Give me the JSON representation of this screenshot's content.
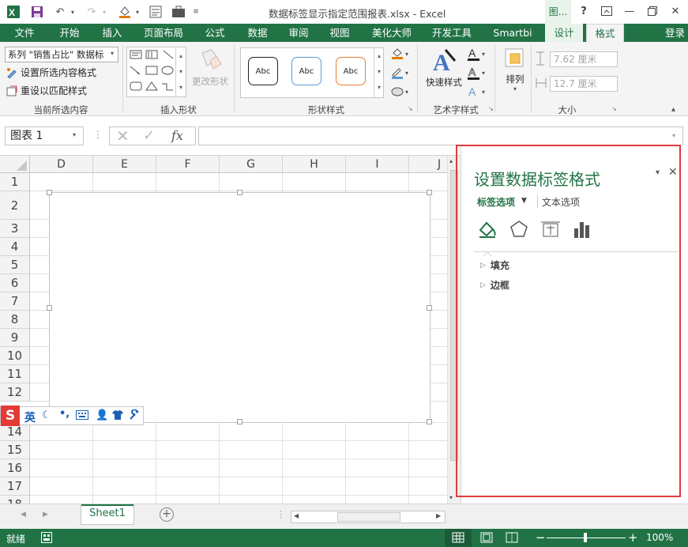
{
  "window": {
    "title": "数据标签显示指定范围报表.xlsx - Excel",
    "tool_context": "图...",
    "help": "?",
    "login": "登录"
  },
  "quick_access": [
    "save-icon",
    "undo-icon",
    "redo-icon",
    "fill-color-icon",
    "form-icon",
    "briefcase-icon",
    "customize-icon"
  ],
  "tabs": [
    "文件",
    "开始",
    "插入",
    "页面布局",
    "公式",
    "数据",
    "审阅",
    "视图",
    "美化大师",
    "开发工具",
    "Smartbi",
    "设计",
    "格式"
  ],
  "ribbon": {
    "current_selection": {
      "dropdown": "系列 \"销售占比\" 数据标",
      "format_selection": "设置所选内容格式",
      "reset_style": "重设以匹配样式",
      "label": "当前所选内容"
    },
    "insert_shapes": {
      "change_shape": "更改形状",
      "label": "插入形状"
    },
    "shape_styles": {
      "samples": [
        "Abc",
        "Abc",
        "Abc"
      ],
      "label": "形状样式"
    },
    "wordart": {
      "quick_styles": "快速样式",
      "label": "艺术字样式"
    },
    "arrange": {
      "label": "排列"
    },
    "size": {
      "height": "7.62 厘米",
      "width": "12.7 厘米",
      "label": "大小"
    }
  },
  "formula_bar": {
    "name_box": "图表 1",
    "fx": "fx"
  },
  "grid": {
    "columns": [
      "D",
      "E",
      "F",
      "G",
      "H",
      "I",
      "J"
    ],
    "rows": [
      "1",
      "2",
      "3",
      "4",
      "5",
      "6",
      "7",
      "8",
      "9",
      "10",
      "11",
      "12",
      "14",
      "15",
      "16",
      "17",
      "18"
    ]
  },
  "ime": {
    "lang": "英",
    "logo": "S"
  },
  "panel": {
    "title": "设置数据标签格式",
    "tab_label_options": "标签选项",
    "tab_text_options": "文本选项",
    "sections": [
      "填充",
      "边框"
    ],
    "icons": [
      "fill-line-icon",
      "effects-icon",
      "size-properties-icon",
      "label-options-icon"
    ]
  },
  "sheets": [
    "Sheet1"
  ],
  "status": {
    "ready": "就绪",
    "zoom": "100%"
  },
  "colors": {
    "excel_green": "#217346",
    "highlight_red": "#e03a3e",
    "panel_title": "#217346"
  }
}
